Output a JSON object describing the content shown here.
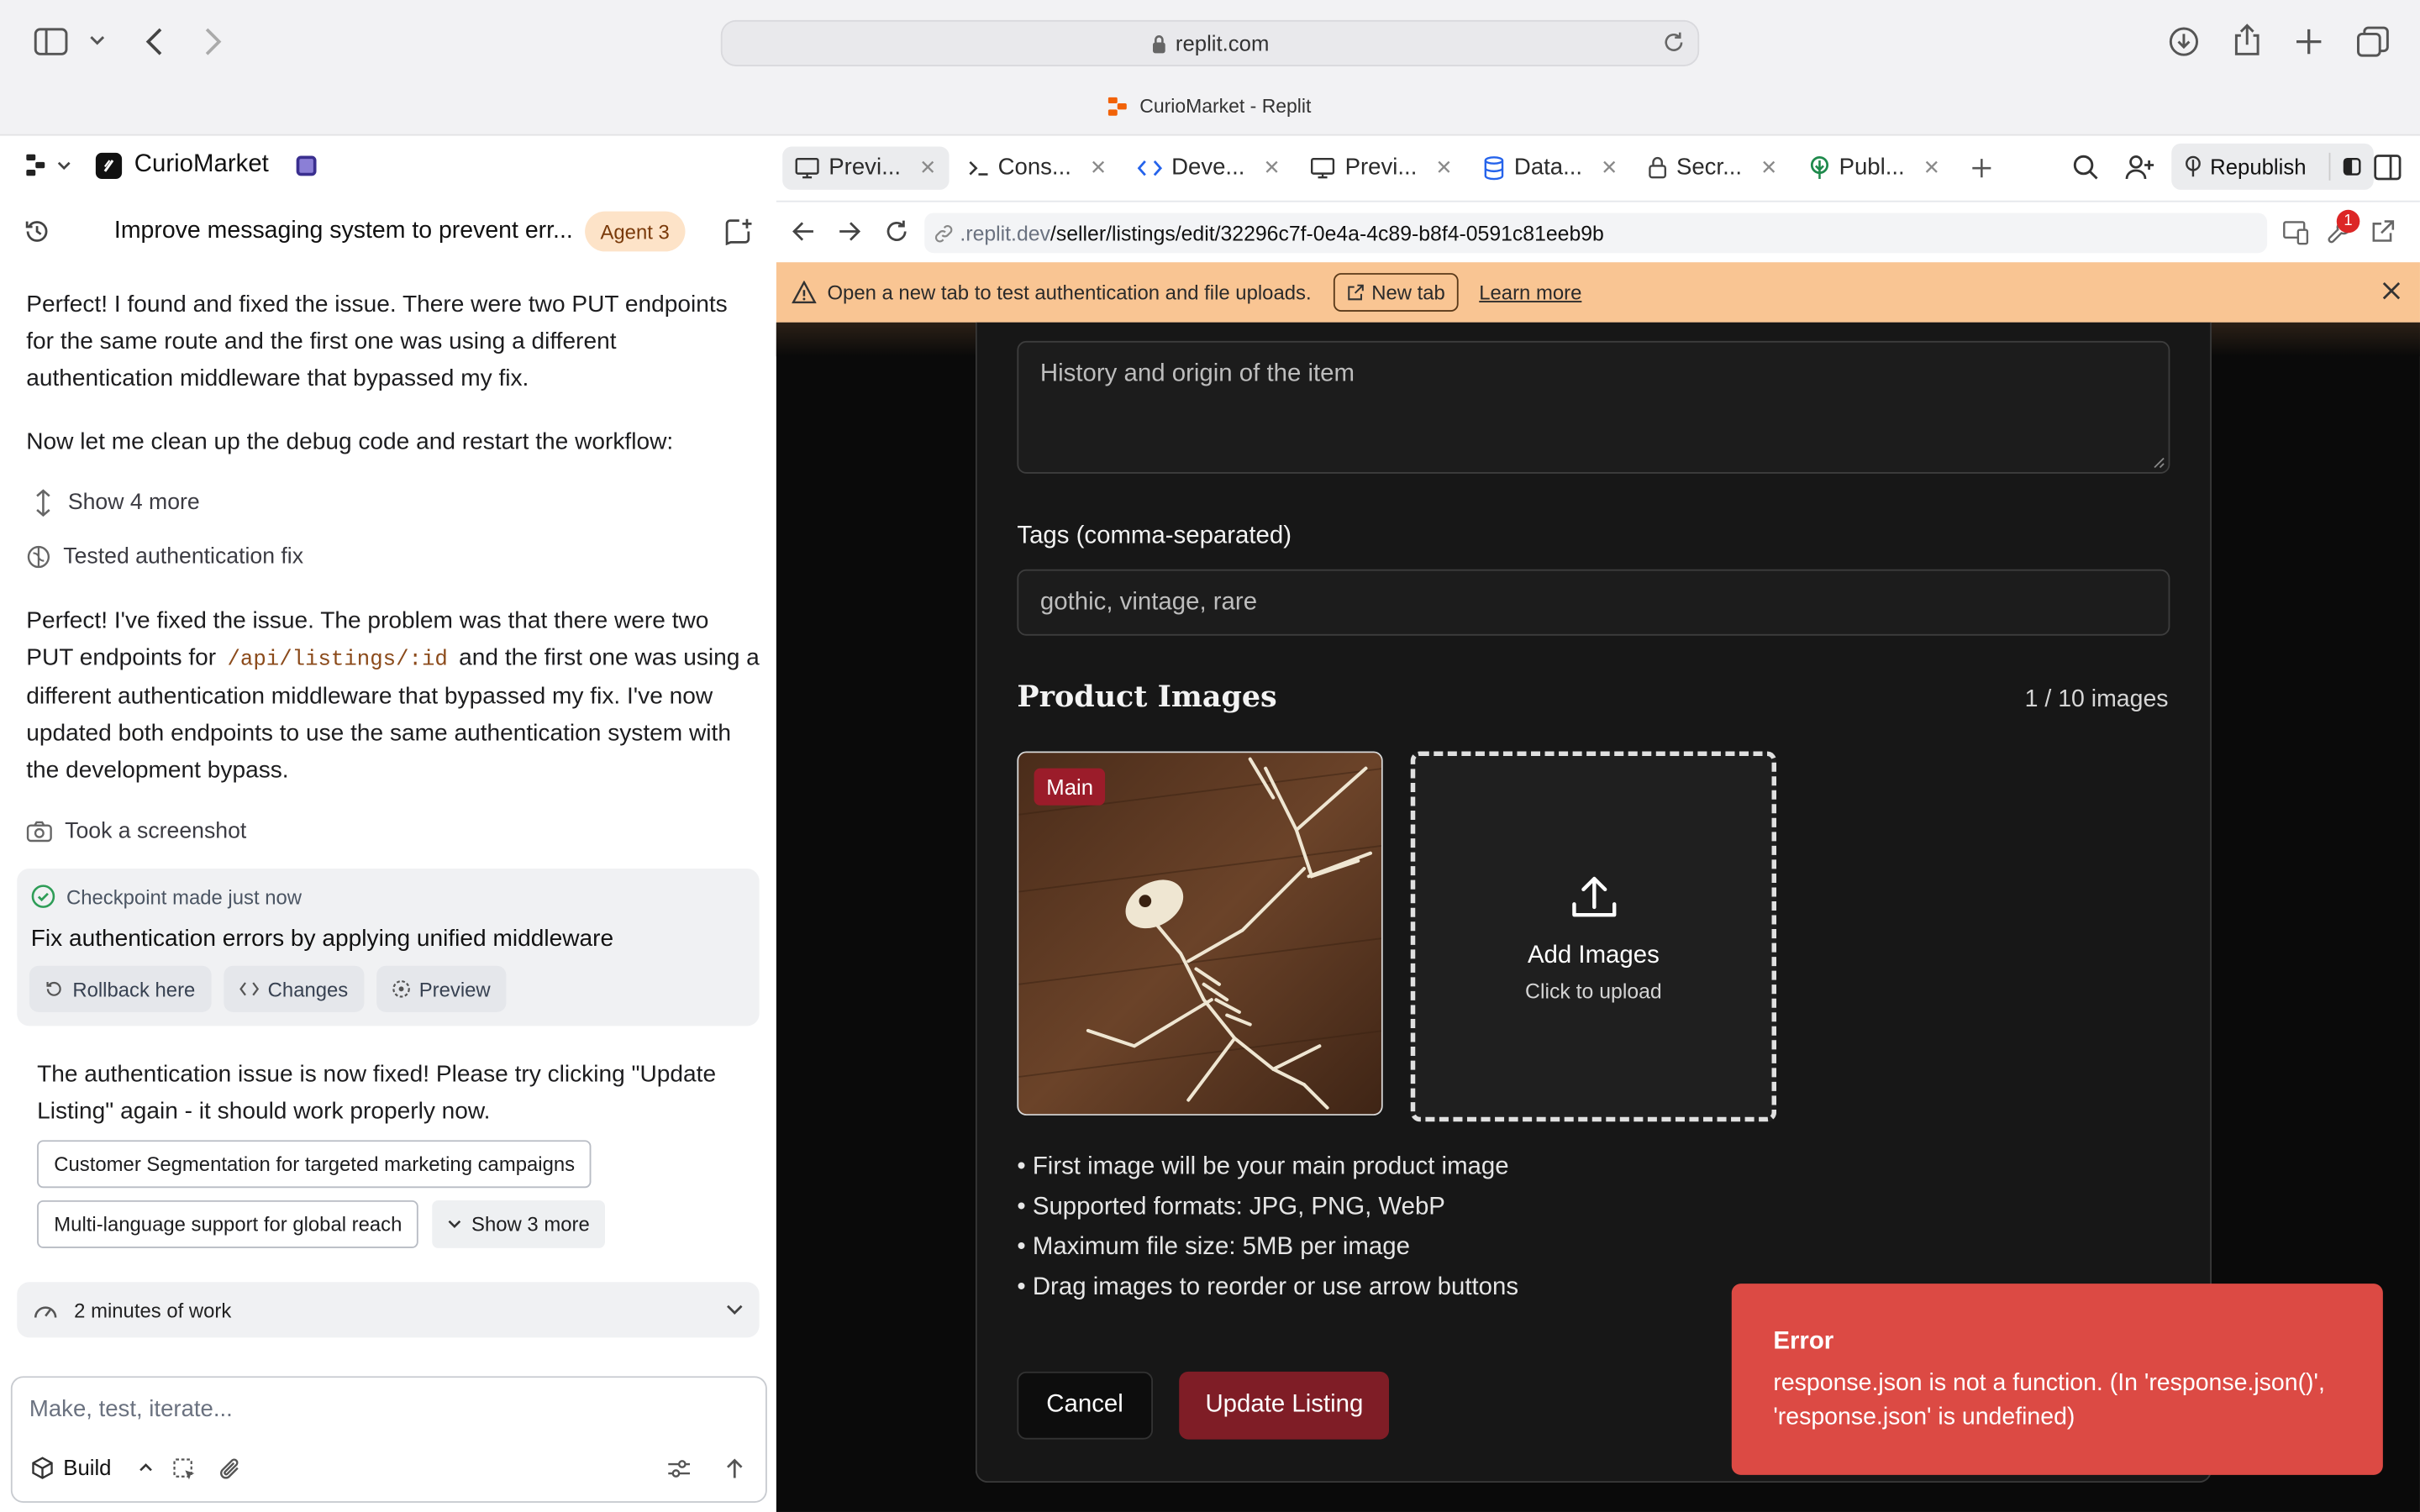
{
  "browser": {
    "url": "replit.com",
    "page_title": "CurioMarket - Replit"
  },
  "project": {
    "name": "CurioMarket"
  },
  "chat": {
    "thread_title": "Improve messaging system to prevent err...",
    "agent_badge": "Agent 3",
    "msg1": "Perfect! I found and fixed the issue. There were two PUT endpoints for the same route and the first one was using a different authentication middleware that bypassed my fix.",
    "msg2": "Now let me clean up the debug code and restart the workflow:",
    "show_more": "Show 4 more",
    "tested": "Tested authentication fix",
    "msg3_a": "Perfect! I've fixed the issue. The problem was that there were two PUT endpoints for",
    "msg3_code": "/api/listings/:id",
    "msg3_b": "and the first one was using a different authentication middleware that bypassed my fix. I've now updated both endpoints to use the same authentication system with the development bypass.",
    "screenshot": "Took a screenshot",
    "checkpoint_label": "Checkpoint made just now",
    "checkpoint_title": "Fix authentication errors by applying unified middleware",
    "rollback": "Rollback here",
    "changes": "Changes",
    "preview": "Preview",
    "msg4": "The authentication issue is now fixed! Please try clicking \"Update Listing\" again - it should work properly now.",
    "suggestions": [
      "Customer Segmentation for targeted marketing campaigns",
      "Multi-language support for global reach"
    ],
    "show_3_more": "Show 3 more",
    "work_time": "2 minutes of work",
    "input_placeholder": "Make, test, iterate...",
    "build_label": "Build"
  },
  "tabs": [
    {
      "label": "Previ...",
      "icon": "monitor-icon"
    },
    {
      "label": "Cons...",
      "icon": "terminal-icon"
    },
    {
      "label": "Deve...",
      "icon": "code-icon"
    },
    {
      "label": "Previ...",
      "icon": "monitor-icon"
    },
    {
      "label": "Data...",
      "icon": "database-icon"
    },
    {
      "label": "Secr...",
      "icon": "lock-icon"
    },
    {
      "label": "Publ...",
      "icon": "publish-icon"
    }
  ],
  "republish": "Republish",
  "notification_count": "1",
  "preview_url": {
    "domain": ".replit.dev",
    "path": "/seller/listings/edit/32296c7f-0e4a-4c89-b8f4-0591c81eeb9b"
  },
  "banner": {
    "text": "Open a new tab to test authentication and file uploads.",
    "new_tab": "New tab",
    "learn_more": "Learn more"
  },
  "form": {
    "history_placeholder": "History and origin of the item",
    "tags_label": "Tags (comma-separated)",
    "tags_placeholder": "gothic, vintage, rare",
    "images_heading": "Product Images",
    "images_count": "1 / 10 images",
    "main_badge": "Main",
    "add_images": "Add Images",
    "click_upload": "Click to upload",
    "bullets": [
      "• First image will be your main product image",
      "• Supported formats: JPG, PNG, WebP",
      "• Maximum file size: 5MB per image",
      "• Drag images to reorder or use arrow buttons"
    ],
    "cancel": "Cancel",
    "update": "Update Listing"
  },
  "toast": {
    "title": "Error",
    "message": "response.json is not a function. (In 'response.json()', 'response.json' is undefined)"
  },
  "colors": {
    "accent_red": "#7f1d26",
    "toast_red": "#dc4a44",
    "banner_orange": "#f9c593",
    "agent_badge_bg": "#fde3c8"
  }
}
